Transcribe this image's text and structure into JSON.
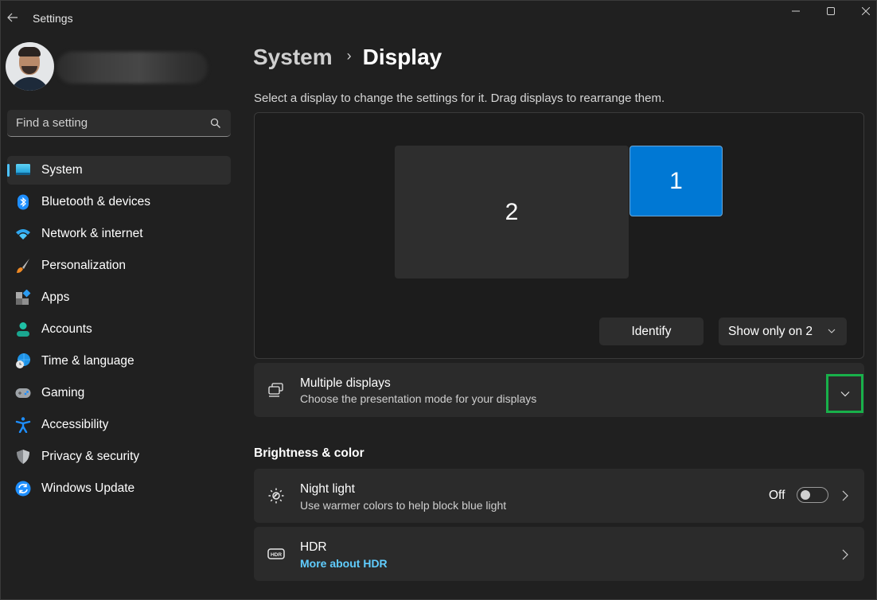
{
  "window": {
    "title": "Settings",
    "controls": {
      "minimize": "minimize",
      "maximize": "maximize",
      "close": "close"
    }
  },
  "sidebar": {
    "search_placeholder": "Find a setting",
    "items": [
      {
        "label": "System",
        "icon": "system-icon",
        "active": true
      },
      {
        "label": "Bluetooth & devices",
        "icon": "bluetooth-icon"
      },
      {
        "label": "Network & internet",
        "icon": "wifi-icon"
      },
      {
        "label": "Personalization",
        "icon": "brush-icon"
      },
      {
        "label": "Apps",
        "icon": "apps-icon"
      },
      {
        "label": "Accounts",
        "icon": "person-icon"
      },
      {
        "label": "Time & language",
        "icon": "globe-clock-icon"
      },
      {
        "label": "Gaming",
        "icon": "gamepad-icon"
      },
      {
        "label": "Accessibility",
        "icon": "accessibility-icon"
      },
      {
        "label": "Privacy & security",
        "icon": "shield-icon"
      },
      {
        "label": "Windows Update",
        "icon": "update-icon"
      }
    ]
  },
  "main": {
    "breadcrumb": {
      "parent": "System",
      "separator": "›",
      "current": "Display"
    },
    "hint": "Select a display to change the settings for it. Drag displays to rearrange them.",
    "monitors": [
      {
        "number": "2",
        "selected": false
      },
      {
        "number": "1",
        "selected": true
      }
    ],
    "identify_label": "Identify",
    "projection_select": {
      "value": "Show only on 2"
    },
    "multiple_displays": {
      "title": "Multiple displays",
      "subtitle": "Choose the presentation mode for your displays"
    },
    "section_brightness": "Brightness & color",
    "night_light": {
      "title": "Night light",
      "subtitle": "Use warmer colors to help block blue light",
      "state_label": "Off",
      "enabled": false
    },
    "hdr": {
      "title": "HDR",
      "link": "More about HDR"
    }
  },
  "colors": {
    "accent": "#0078d4",
    "link": "#60cdff",
    "highlight_box": "#18b04a",
    "background": "#202020",
    "card": "#2b2b2b"
  }
}
